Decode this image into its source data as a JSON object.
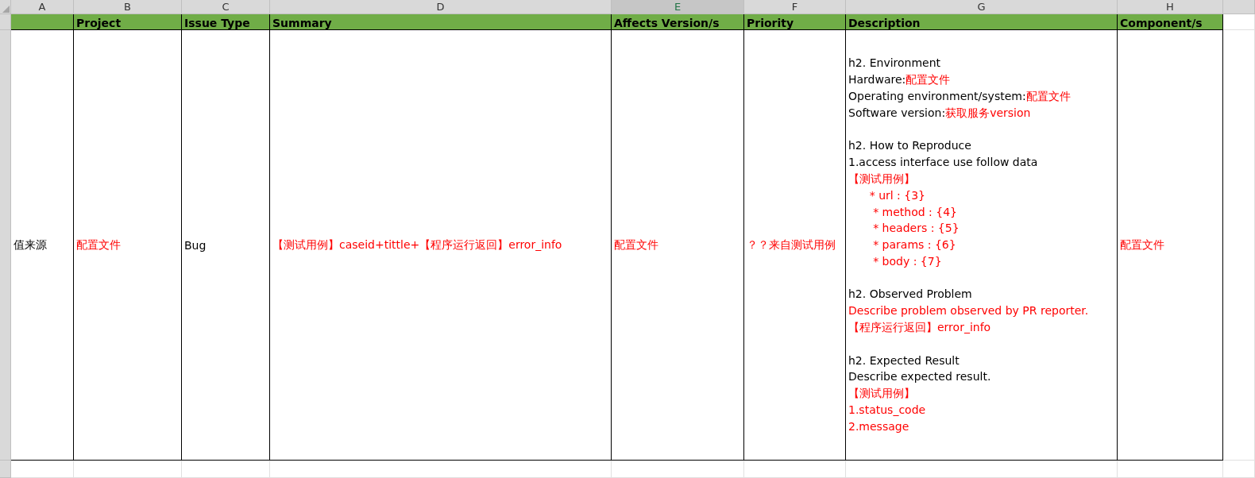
{
  "column_letters": [
    {
      "label": "A",
      "selected": false
    },
    {
      "label": "B",
      "selected": false
    },
    {
      "label": "C",
      "selected": false
    },
    {
      "label": "D",
      "selected": false
    },
    {
      "label": "E",
      "selected": true
    },
    {
      "label": "F",
      "selected": false
    },
    {
      "label": "G",
      "selected": false
    },
    {
      "label": "H",
      "selected": false
    }
  ],
  "header_row": [
    "Project",
    "Issue Type",
    "Summary",
    "Affects Version/s",
    "Priority",
    "Description",
    "Component/s"
  ],
  "data_row": [
    {
      "kind": "text",
      "text": "值来源",
      "color": "#000000"
    },
    {
      "kind": "text",
      "text": "配置文件",
      "color": "#ff0000"
    },
    {
      "kind": "text",
      "text": "Bug",
      "color": "#000000"
    },
    {
      "kind": "text",
      "text": "【测试用例】caseid+tittle+【程序运行返回】error_info",
      "color": "#ff0000"
    },
    {
      "kind": "text",
      "text": "配置文件",
      "color": "#ff0000"
    },
    {
      "kind": "text",
      "text": "？？来自测试用例",
      "color": "#ff0000"
    },
    {
      "kind": "lines",
      "lines": [
        {
          "kind": "blank"
        },
        {
          "kind": "text",
          "segments": [
            {
              "text": "h2. Environment",
              "color": "#000000"
            }
          ]
        },
        {
          "kind": "text",
          "segments": [
            {
              "text": "Hardware:",
              "color": "#000000"
            },
            {
              "text": "配置文件",
              "color": "#ff0000"
            }
          ]
        },
        {
          "kind": "text",
          "segments": [
            {
              "text": "Operating environment/system:",
              "color": "#000000"
            },
            {
              "text": "配置文件",
              "color": "#ff0000"
            }
          ]
        },
        {
          "kind": "text",
          "segments": [
            {
              "text": "Software version:",
              "color": "#000000"
            },
            {
              "text": "获取服务version",
              "color": "#ff0000"
            }
          ]
        },
        {
          "kind": "blank"
        },
        {
          "kind": "text",
          "segments": [
            {
              "text": "h2. How to Reproduce",
              "color": "#000000"
            }
          ]
        },
        {
          "kind": "text",
          "segments": [
            {
              "text": "1.access interface use follow data",
              "color": "#000000"
            }
          ]
        },
        {
          "kind": "text",
          "segments": [
            {
              "text": "【测试用例】",
              "color": "#ff0000"
            }
          ]
        },
        {
          "kind": "text",
          "segments": [
            {
              "text": "      * url : {3}",
              "color": "#ff0000"
            }
          ]
        },
        {
          "kind": "text",
          "segments": [
            {
              "text": "       * method : {4}",
              "color": "#ff0000"
            }
          ]
        },
        {
          "kind": "text",
          "segments": [
            {
              "text": "       * headers : {5}",
              "color": "#ff0000"
            }
          ]
        },
        {
          "kind": "text",
          "segments": [
            {
              "text": "       * params : {6}",
              "color": "#ff0000"
            }
          ]
        },
        {
          "kind": "text",
          "segments": [
            {
              "text": "       * body : {7}",
              "color": "#ff0000"
            }
          ]
        },
        {
          "kind": "blank"
        },
        {
          "kind": "text",
          "segments": [
            {
              "text": "h2. Observed Problem",
              "color": "#000000"
            }
          ]
        },
        {
          "kind": "text",
          "segments": [
            {
              "text": "Describe problem observed by PR reporter.",
              "color": "#ff0000"
            }
          ]
        },
        {
          "kind": "text",
          "segments": [
            {
              "text": "【程序运行返回】error_info",
              "color": "#ff0000"
            }
          ]
        },
        {
          "kind": "blank"
        },
        {
          "kind": "text",
          "segments": [
            {
              "text": "h2. Expected Result",
              "color": "#000000"
            }
          ]
        },
        {
          "kind": "text",
          "segments": [
            {
              "text": "Describe expected result.",
              "color": "#000000"
            }
          ]
        },
        {
          "kind": "text",
          "segments": [
            {
              "text": "【测试用例】",
              "color": "#ff0000"
            }
          ]
        },
        {
          "kind": "text",
          "segments": [
            {
              "text": "1.status_code",
              "color": "#ff0000"
            }
          ]
        },
        {
          "kind": "text",
          "segments": [
            {
              "text": "2.message",
              "color": "#ff0000"
            }
          ]
        },
        {
          "kind": "blank"
        }
      ]
    },
    {
      "kind": "text",
      "text": "配置文件",
      "color": "#ff0000"
    }
  ]
}
